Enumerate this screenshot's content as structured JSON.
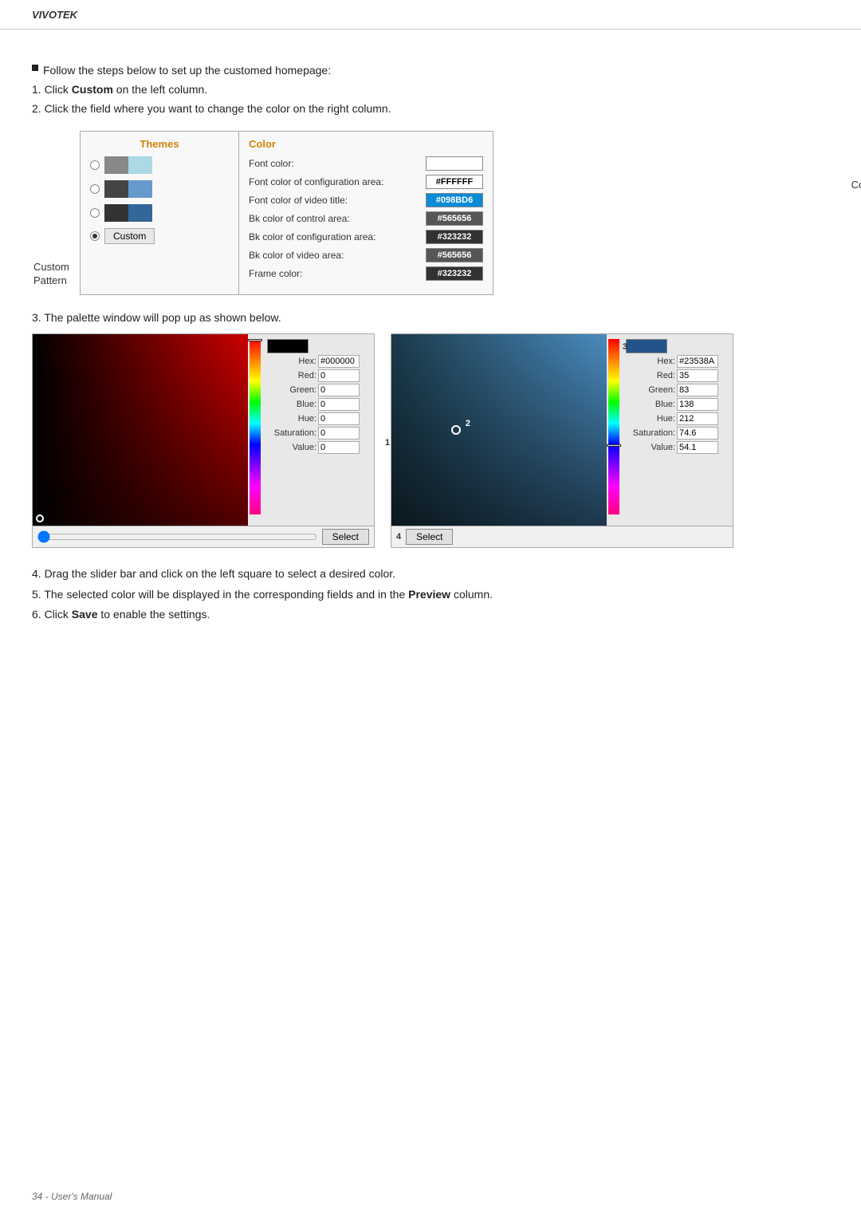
{
  "header": {
    "title": "VIVOTEK"
  },
  "instructions": {
    "line1": "Follow the steps below to set up the customed homepage:",
    "step1": "Click Custom on the left column.",
    "step2": "Click the field where you want to change the color on the right column.",
    "step1_bold": "Custom",
    "step2_end": "on the right column."
  },
  "themes_panel": {
    "title": "Themes",
    "custom_label": "Custom\nPattern",
    "custom_button": "Custom"
  },
  "color_panel": {
    "title": "Color",
    "rows": [
      {
        "label": "Font color:",
        "color": "",
        "hex": ""
      },
      {
        "label": "Font color of configuration area:",
        "color": "#FFFFFF",
        "hex": "#FFFFFF",
        "bg": "#ffffff",
        "textColor": "#000"
      },
      {
        "label": "Font color of video title:",
        "color": "#098BD6",
        "hex": "#098BD6",
        "bg": "#098BD6",
        "textColor": "#fff"
      },
      {
        "label": "Bk color of control area:",
        "color": "#565656",
        "hex": "#565656",
        "bg": "#565656",
        "textColor": "#fff"
      },
      {
        "label": "Bk color of configuration area:",
        "color": "#323232",
        "hex": "#323232",
        "bg": "#323232",
        "textColor": "#fff"
      },
      {
        "label": "Bk color of video area:",
        "color": "#565656",
        "hex": "#565656",
        "bg": "#565656",
        "textColor": "#fff"
      },
      {
        "label": "Frame color:",
        "color": "#323232",
        "hex": "#323232",
        "bg": "#323232",
        "textColor": "#fff"
      }
    ],
    "color_selector_label": "Color Selector"
  },
  "step3": {
    "heading": "3. The palette window will pop up as shown below."
  },
  "picker1": {
    "hex_label": "Hex:",
    "hex_value": "#000000",
    "red_label": "Red:",
    "red_value": "0",
    "green_label": "Green:",
    "green_value": "0",
    "blue_label": "Blue:",
    "blue_value": "0",
    "hue_label": "Hue:",
    "hue_value": "0",
    "sat_label": "Saturation:",
    "sat_value": "0",
    "val_label": "Value:",
    "val_value": "0",
    "select_btn": "Select"
  },
  "picker2": {
    "num_label": "1",
    "circle_label": "2",
    "num3_label": "3",
    "num4_label": "4",
    "hex_label": "Hex:",
    "hex_value": "#23538A",
    "red_label": "Red:",
    "red_value": "35",
    "green_label": "Green:",
    "green_value": "83",
    "blue_label": "Blue:",
    "blue_value": "138",
    "hue_label": "Hue:",
    "hue_value": "212",
    "sat_label": "Saturation:",
    "sat_value": "74.6",
    "val_label": "Value:",
    "val_value": "54.1",
    "select_btn": "Select"
  },
  "steps_bottom": {
    "step4": "4. Drag the slider bar and click on the left square to select a desired color.",
    "step5_pre": "5. The selected color will be displayed in the corresponding fields and in the ",
    "step5_bold": "Preview",
    "step5_post": " column.",
    "step6_pre": "6. Click ",
    "step6_bold": "Save",
    "step6_post": " to enable the settings."
  },
  "footer": {
    "text": "34 - User's Manual"
  }
}
